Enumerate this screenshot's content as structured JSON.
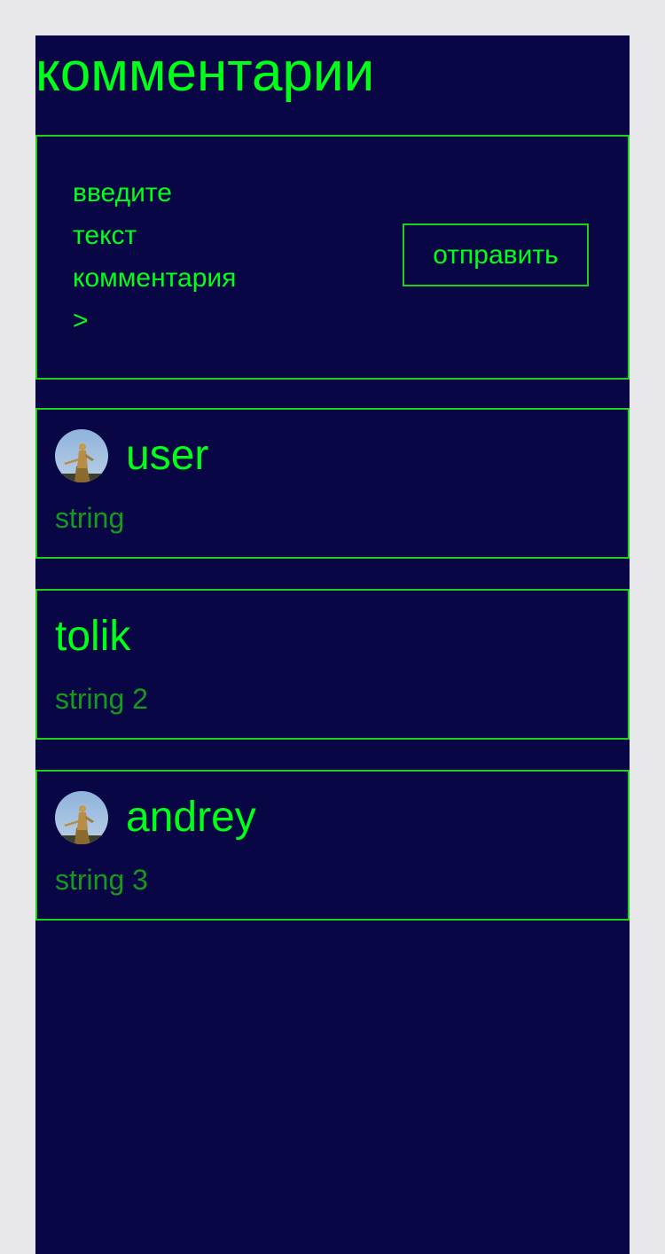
{
  "page": {
    "title": "комментарии"
  },
  "compose": {
    "placeholder_lines": [
      "введите",
      "текст",
      "комментария",
      ">"
    ],
    "send_label": "отправить"
  },
  "comments": [
    {
      "username": "user",
      "text": "string",
      "has_avatar": true
    },
    {
      "username": "tolik",
      "text": "string 2",
      "has_avatar": false
    },
    {
      "username": "andrey",
      "text": "string 3",
      "has_avatar": true
    }
  ],
  "colors": {
    "background": "#090645",
    "outer_background": "#e8e8ea",
    "accent": "#00ff19",
    "border": "#1ed11e",
    "comment_text": "#159a1e"
  }
}
